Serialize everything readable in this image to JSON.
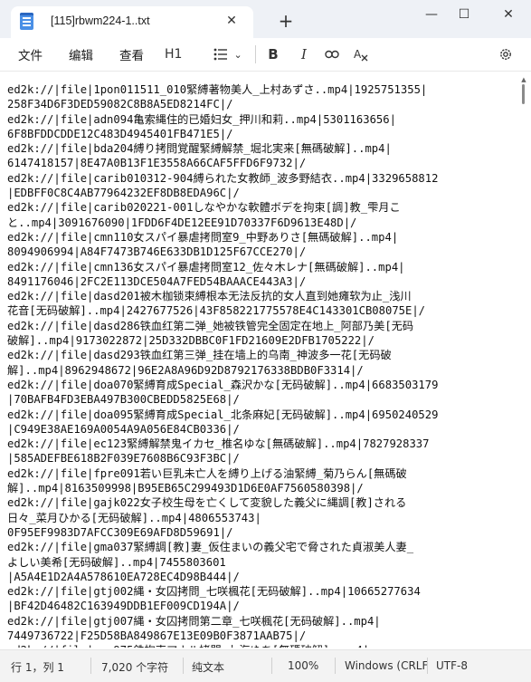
{
  "window": {
    "tab_title": "[115]rbwm224-1..txt",
    "new_tab_glyph": "+",
    "close_glyph": "✕",
    "min_glyph": "—",
    "max_glyph": "☐"
  },
  "menu": {
    "file": "文件",
    "edit": "编辑",
    "view": "查看"
  },
  "toolbar": {
    "heading": "H1",
    "heading_chevron": "⌄",
    "list_chevron": "⌄",
    "bold": "B",
    "italic": "I"
  },
  "lines": [
    "ed2k://|file|1pon011511_010緊縛著物美人_上村あずさ..mp4|1925751355|",
    "258F34D6F3DED59082C8B8A5ED8214FC|/",
    "ed2k://|file|adn094亀索縄住的已婚妇女_押川和莉..mp4|5301163656|",
    "6F8BFDDCDDE12C483D4945401FB471E5|/",
    "ed2k://|file|bda204縛り拷問覚醒緊縛解禁_堀北実来[無碼破解]..mp4|",
    "6147418157|8E47A0B13F1E3558A66CAF5FFD6F9732|/",
    "ed2k://|file|carib010312-904縛られた女教師_波多野結衣..mp4|3329658812",
    "|EDBFF0C8C4AB77964232EF8DB8EDA96C|/",
    "ed2k://|file|carib020221-001しなやかな軟體ボデを拘束[調]教_雫月こ",
    "と..mp4|3091676090|1FDD6F4DE12EE91D70337F6D9613E48D|/",
    "ed2k://|file|cmn110女スパイ暴虐拷問室9_中野ありさ[無碼破解]..mp4|",
    "8094906994|A84F7473B746E633DB1D125F67CCE270|/",
    "ed2k://|file|cmn136女スパイ暴虐拷問室12_佐々木レナ[無碼破解]..mp4|",
    "8491176046|2FC2E113DCE504A7FED54BAAACE443A3|/",
    "ed2k://|file|dasd201被木枷锁束縛根本无法反抗的女人直到她瘫软为止_浅川",
    "花音[无码破解]..mp4|2427677526|43F858221775578E4C143301CB08075E|/",
    "ed2k://|file|dasd286铁血红第二弹_她被铁管完全固定在地上_阿部乃美[无码",
    "破解]..mp4|9173022872|25D332DBBC0F1FD21609E2DFB1705222|/",
    "ed2k://|file|dasd293铁血红第三弹_挂在墙上的乌南_神波多一花[无码破",
    "解]..mp4|8962948672|96E2A8A96D92D8792176338BDB0F3314|/",
    "ed2k://|file|doa070緊縛育成Special_森沢かな[无码破解]..mp4|6683503179",
    "|70BAFB4FD3EBA497B300CBEDD5825E68|/",
    "ed2k://|file|doa095緊縛育成Special_北条麻妃[无码破解]..mp4|6950240529",
    "|C949E38AE169A0054A9A056E84CB0336|/",
    "ed2k://|file|ec123緊縛解禁鬼イカセ_椎名ゆな[無碼破解]..mp4|7827928337",
    "|585ADEFBE618B2F039E7608B6C93F3BC|/",
    "ed2k://|file|fpre091若い巨乳未亡人を縛り上げる油緊縛_菊乃らん[無碼破",
    "解]..mp4|8163509998|B95EB65C299493D1D6E0AF7560580398|/",
    "ed2k://|file|gajk022女子校生母を亡くして変貌した義父に縄調[教]される",
    "日々_菜月ひかる[无码破解]..mp4|4806553743|",
    "0F95EF9983D7AFCC309E69AFD8D59691|/",
    "ed2k://|file|gma037緊縛調[教]妻_仮住まいの義父宅で脅された貞淑美人妻_",
    "よしい美希[无码破解]..mp4|7455803601",
    "|A5A4E1D2A4A578610EA728EC4D98B444|/",
    "ed2k://|file|gtj002縄・女囚拷問_七咲楓花[无码破解]..mp4|10665277634",
    "|BF42D46482C163949DDB1EF009CD194A|/",
    "ed2k://|file|gtj007縄・女囚拷問第二章_七咲楓花[无码破解]..mp4|",
    "7449736722|F25D58BA849867E13E09B0F3871AAB75|/",
    "ed2k://|file|gvg975鉄拘束アナル拷問_七海ゆあ[無碼破解]..mp4|",
    "4160675462|1170D90093B39EDB20E61CCE3207B8E0|/",
    "ed2k://|file|hey139緊縛研究所 激しくされると興奮します 双葉みお..mp4|"
  ],
  "status": {
    "position": "行 1，列 1",
    "chars": "7,020 个字符",
    "format": "纯文本",
    "zoom": "100%",
    "eol": "Windows (CRLF",
    "encoding": "UTF-8"
  }
}
